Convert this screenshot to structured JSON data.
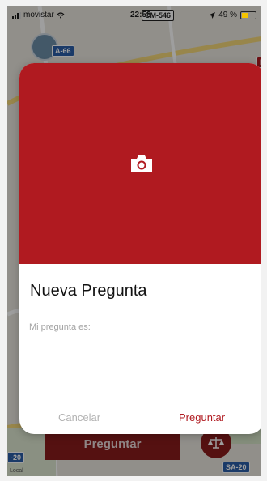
{
  "status_bar": {
    "carrier": "movistar",
    "time": "22:58",
    "battery": "49 %",
    "colors": {
      "battery_fill": "#f5c400"
    }
  },
  "map": {
    "road_labels": [
      "A-66",
      "CM-546",
      "N",
      "-20",
      "SA-20"
    ],
    "small_label": "Local"
  },
  "background": {
    "ask_button_label": "Preguntar"
  },
  "modal": {
    "title": "Nueva Pregunta",
    "input_placeholder": "Mi pregunta es:",
    "cancel_label": "Cancelar",
    "submit_label": "Preguntar",
    "camera_icon": "camera-icon",
    "colors": {
      "banner": "#b01a20",
      "accent": "#b01a20"
    }
  }
}
